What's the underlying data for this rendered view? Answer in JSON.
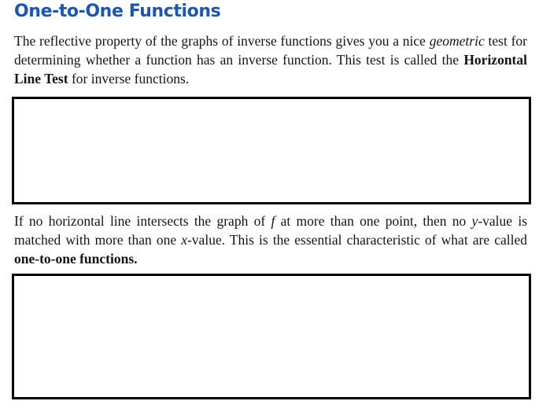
{
  "section": {
    "title": "One-to-One Functions"
  },
  "paragraph1": {
    "text_a": "The reflective property of the graphs of inverse functions gives you a nice ",
    "emphasis": "geometric",
    "text_b": " test for determining whether a function has an inverse function. This test is called the ",
    "bold_term": "Horizontal Line Test",
    "text_c": " for inverse functions."
  },
  "paragraph2": {
    "text_a": "If no horizontal line intersects the graph of ",
    "var_f": "f",
    "text_b": " at more than one point, then no ",
    "var_y": "y",
    "text_c": "-value is matched with more than one ",
    "var_x": "x",
    "text_d": "-value. This is the essential characteristic of what are called ",
    "bold_term": "one-to-one functions.",
    "text_e": ""
  },
  "colors": {
    "heading": "#1f56a8",
    "body_text": "#141414",
    "frame_border": "#000000"
  }
}
